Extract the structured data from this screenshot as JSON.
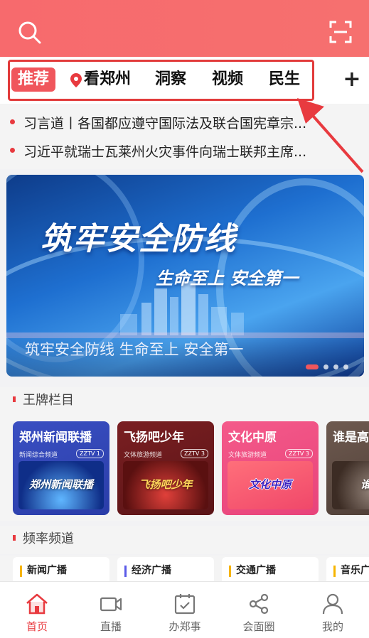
{
  "header": {
    "search_icon": "search-icon",
    "scan_icon": "scan-icon",
    "bg_color": "#f76a6d"
  },
  "tabs": {
    "active": "推荐",
    "items": [
      "看郑州",
      "洞察",
      "视频",
      "民生"
    ],
    "add": "+"
  },
  "headlines": [
    "习言道丨各国都应遵守国际法及联合国宪章宗...",
    "习近平就瑞士瓦莱州火灾事件向瑞士联邦主席..."
  ],
  "banner": {
    "title": "筑牢安全防线",
    "subtitle": "生命至上 安全第一",
    "caption": "筑牢安全防线 生命至上 安全第一"
  },
  "sections": {
    "featured": "王牌栏目",
    "frequency": "频率频道"
  },
  "cards": [
    {
      "title": "郑州新闻联播",
      "channel": "新闻综合频道",
      "badge": "ZZTV 1",
      "image_text": "郑州新闻联播"
    },
    {
      "title": "飞扬吧少年",
      "channel": "文体旅游频道",
      "badge": "ZZTV 3",
      "image_text": "飞扬吧少年"
    },
    {
      "title": "文化中原",
      "channel": "文体旅游频道",
      "badge": "ZZTV 3",
      "image_text": "文化中原"
    },
    {
      "title": "谁是高",
      "channel": "",
      "badge": "",
      "image_text": "谁是"
    }
  ],
  "frequencies": [
    "新闻广播",
    "经济广播",
    "交通广播",
    "音乐广"
  ],
  "bottom_nav": [
    {
      "label": "首页",
      "icon": "home-icon"
    },
    {
      "label": "直播",
      "icon": "video-camera-icon"
    },
    {
      "label": "办郑事",
      "icon": "calendar-check-icon"
    },
    {
      "label": "会面圈",
      "icon": "share-icon"
    },
    {
      "label": "我的",
      "icon": "user-icon"
    }
  ],
  "accent_color": "#e83a3f"
}
